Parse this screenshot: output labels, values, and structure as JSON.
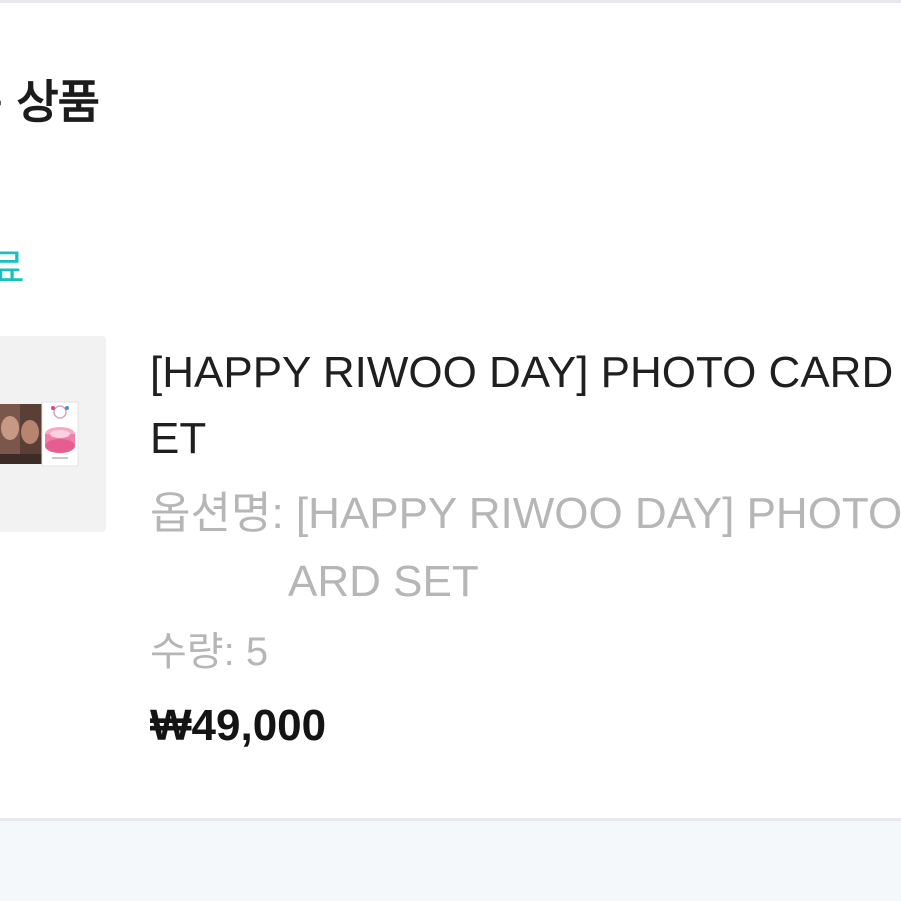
{
  "section": {
    "title": "문 상품"
  },
  "order": {
    "status": "완료",
    "status_color": "#17c1bd"
  },
  "item": {
    "thumbnail_icon": "product-photo-card-set-image",
    "name_line1": "[HAPPY RIWOO DAY] PHOTO CARD S",
    "name_line2": "ET",
    "option_line1": "옵션명: [HAPPY RIWOO DAY] PHOTO C",
    "option_line2": "ARD SET",
    "quantity": "수량: 5",
    "price": "₩49,000"
  }
}
